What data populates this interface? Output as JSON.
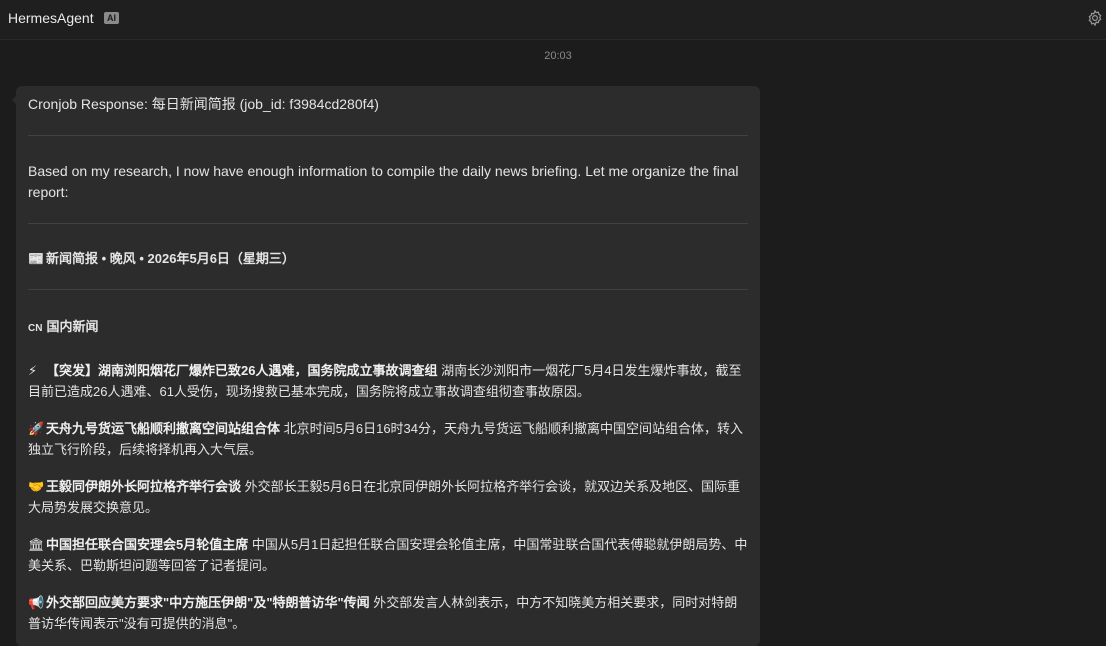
{
  "header": {
    "app_name": "HermesAgent",
    "ai_badge": "AI",
    "settings_icon": "gear-icon"
  },
  "chat": {
    "timestamp": "20:03",
    "message": {
      "title": "Cronjob Response: 每日新闻简报 (job_id: f3984cd280f4)",
      "intro": "Based on my research, I now have enough information to compile the daily news briefing. Let me organize the final report:",
      "report_emoji": "📰",
      "report_heading": "新闻简报 • 晚风 • 2026年5月6日（星期三）",
      "section_flag": "CN",
      "section_title": "国内新闻",
      "items": [
        {
          "emoji": "⚡",
          "headline": "【突发】湖南浏阳烟花厂爆炸已致26人遇难，国务院成立事故调查组",
          "body": "湖南长沙浏阳市一烟花厂5月4日发生爆炸事故，截至目前已造成26人遇难、61人受伤，现场搜救已基本完成，国务院将成立事故调查组彻查事故原因。"
        },
        {
          "emoji": "🚀",
          "headline": "天舟九号货运飞船顺利撤离空间站组合体",
          "body": "北京时间5月6日16时34分，天舟九号货运飞船顺利撤离中国空间站组合体，转入独立飞行阶段，后续将择机再入大气层。"
        },
        {
          "emoji": "🤝",
          "headline": "王毅同伊朗外长阿拉格齐举行会谈",
          "body": "外交部长王毅5月6日在北京同伊朗外长阿拉格齐举行会谈，就双边关系及地区、国际重大局势发展交换意见。"
        },
        {
          "emoji": "🏛",
          "headline": "中国担任联合国安理会5月轮值主席",
          "body": "中国从5月1日起担任联合国安理会轮值主席，中国常驻联合国代表傅聪就伊朗局势、中美关系、巴勒斯坦问题等回答了记者提问。"
        },
        {
          "emoji": "📢",
          "headline": "外交部回应美方要求\"中方施压伊朗\"及\"特朗普访华\"传闻",
          "body": "外交部发言人林剑表示，中方不知晓美方相关要求，同时对特朗普访华传闻表示\"没有可提供的消息\"。"
        }
      ]
    }
  }
}
